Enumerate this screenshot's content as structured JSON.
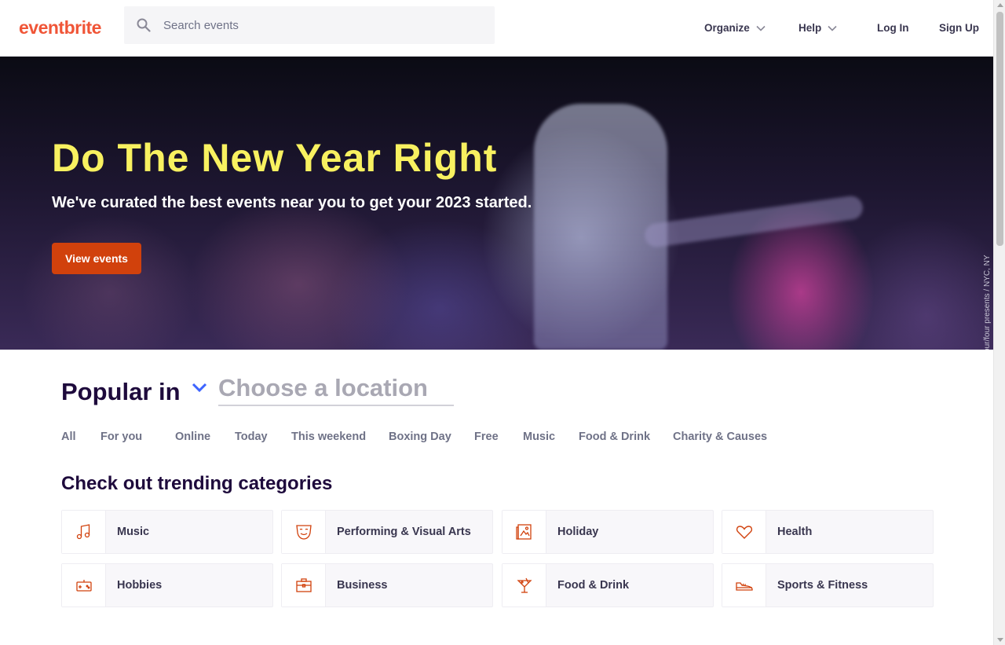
{
  "header": {
    "logo": "eventbrite",
    "search_placeholder": "Search events",
    "nav": {
      "organize": "Organize",
      "help": "Help",
      "login": "Log In",
      "signup": "Sign Up"
    }
  },
  "hero": {
    "title": "Do The New Year Right",
    "subtitle": "We've curated the best events near you to get your 2023 started.",
    "button": "View events",
    "credit": "Open Air / four/four presents / NYC, NY"
  },
  "popular": {
    "label": "Popular in",
    "location_placeholder": "Choose a location",
    "tabs": [
      "All",
      "For you",
      "Online",
      "Today",
      "This weekend",
      "Boxing Day",
      "Free",
      "Music",
      "Food & Drink",
      "Charity & Causes"
    ]
  },
  "trending": {
    "title": "Check out trending categories",
    "categories": [
      {
        "label": "Music",
        "icon": "music-note-icon"
      },
      {
        "label": "Performing & Visual Arts",
        "icon": "theater-mask-icon"
      },
      {
        "label": "Holiday",
        "icon": "picture-icon"
      },
      {
        "label": "Health",
        "icon": "heart-icon"
      },
      {
        "label": "Hobbies",
        "icon": "game-controller-icon"
      },
      {
        "label": "Business",
        "icon": "briefcase-icon"
      },
      {
        "label": "Food & Drink",
        "icon": "cocktail-icon"
      },
      {
        "label": "Sports & Fitness",
        "icon": "sneaker-icon"
      }
    ]
  },
  "colors": {
    "brand": "#f05537",
    "cta": "#d1410c",
    "hero_title": "#f8f160",
    "icon": "#d1410c"
  }
}
